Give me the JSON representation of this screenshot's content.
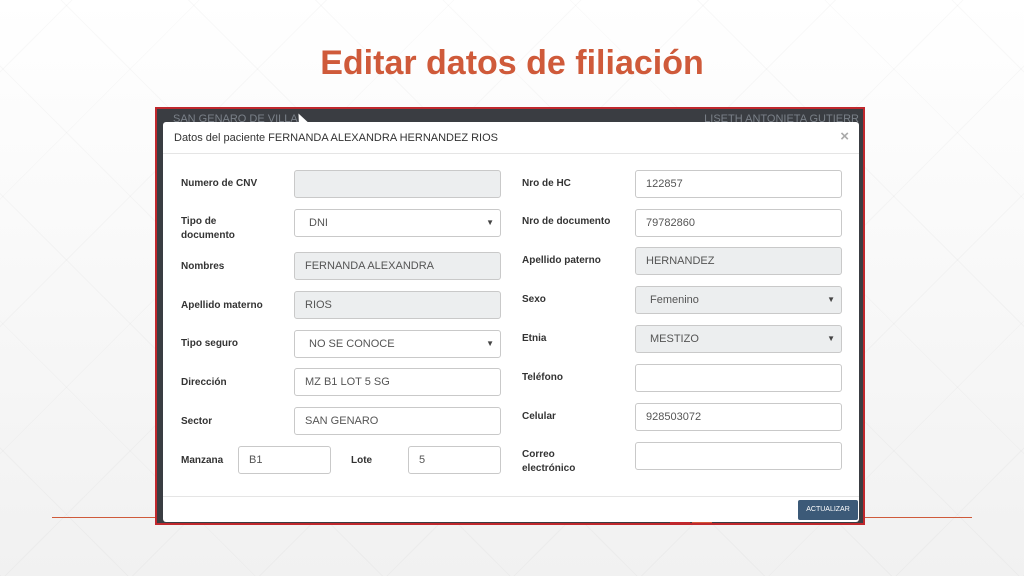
{
  "slide": {
    "title": "Editar datos de filiación"
  },
  "app_bar": {
    "left_text": "SAN GENARO DE VILLA",
    "right_text": "LISETH ANTONIETA  GUTIERR"
  },
  "modal": {
    "title": "Datos del paciente FERNANDA ALEXANDRA HERNANDEZ RIOS",
    "close_glyph": "×",
    "update_label": "ACTUALIZAR"
  },
  "form": {
    "numero_cnv": {
      "label": "Numero de CNV",
      "value": ""
    },
    "tipo_documento": {
      "label_line1": "Tipo de",
      "label_line2": "documento",
      "value": "DNI"
    },
    "nombres": {
      "label": "Nombres",
      "value": "FERNANDA ALEXANDRA"
    },
    "apellido_materno": {
      "label": "Apellido materno",
      "value": "RIOS"
    },
    "tipo_seguro": {
      "label": "Tipo seguro",
      "value": "NO SE CONOCE"
    },
    "direccion": {
      "label": "Dirección",
      "value": "MZ B1 LOT 5 SG"
    },
    "sector": {
      "label": "Sector",
      "value": "SAN GENARO"
    },
    "manzana": {
      "label": "Manzana",
      "value": "B1"
    },
    "lote": {
      "label": "Lote",
      "value": "5"
    },
    "nro_hc": {
      "label": "Nro de HC",
      "value": "122857"
    },
    "nro_documento": {
      "label": "Nro de documento",
      "value": "79782860"
    },
    "apellido_paterno": {
      "label": "Apellido paterno",
      "value": "HERNANDEZ"
    },
    "sexo": {
      "label": "Sexo",
      "value": "Femenino"
    },
    "etnia": {
      "label": "Etnia",
      "value": "MESTIZO"
    },
    "telefono": {
      "label": "Teléfono",
      "value": ""
    },
    "celular": {
      "label": "Celular",
      "value": "928503072"
    },
    "correo": {
      "label_line1": "Correo",
      "label_line2": "electrónico",
      "value": ""
    }
  },
  "icons": {
    "dropdown": "▼",
    "cursor": "mouse-pointer-icon"
  },
  "colors": {
    "title": "#cf5a3a",
    "frame_border": "#c0282d",
    "update_button": "#3c5a78"
  }
}
